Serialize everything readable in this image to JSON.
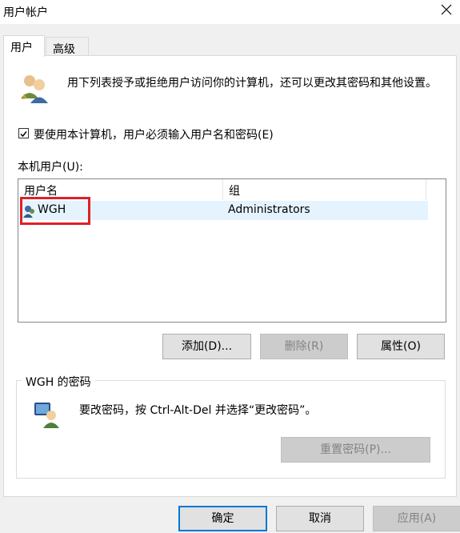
{
  "window": {
    "title": "用户帐户",
    "close_icon": "close-icon"
  },
  "tabs": [
    {
      "label": "用户",
      "active": true
    },
    {
      "label": "高级",
      "active": false
    }
  ],
  "description": "用下列表授予或拒绝用户访问你的计算机，还可以更改其密码和其他设置。",
  "require_login": {
    "label": "要使用本计算机，用户必须输入用户名和密码(E)",
    "checked": true
  },
  "local_users": {
    "label": "本机用户(U):",
    "columns": [
      "用户名",
      "组"
    ],
    "rows": [
      {
        "name": "WGH",
        "group": "Administrators",
        "selected": true
      }
    ]
  },
  "user_buttons": {
    "add": "添加(D)...",
    "remove": "删除(R)",
    "properties": "属性(O)"
  },
  "password_group": {
    "title": "WGH 的密码",
    "text": "要改密码，按 Ctrl-Alt-Del 并选择“更改密码”。",
    "reset": "重置密码(P)..."
  },
  "dialog_buttons": {
    "ok": "确定",
    "cancel": "取消",
    "apply": "应用(A)"
  },
  "colors": {
    "accent": "#0078d7",
    "highlight_box": "#e01f27",
    "selected_row": "#e5f3ff"
  }
}
